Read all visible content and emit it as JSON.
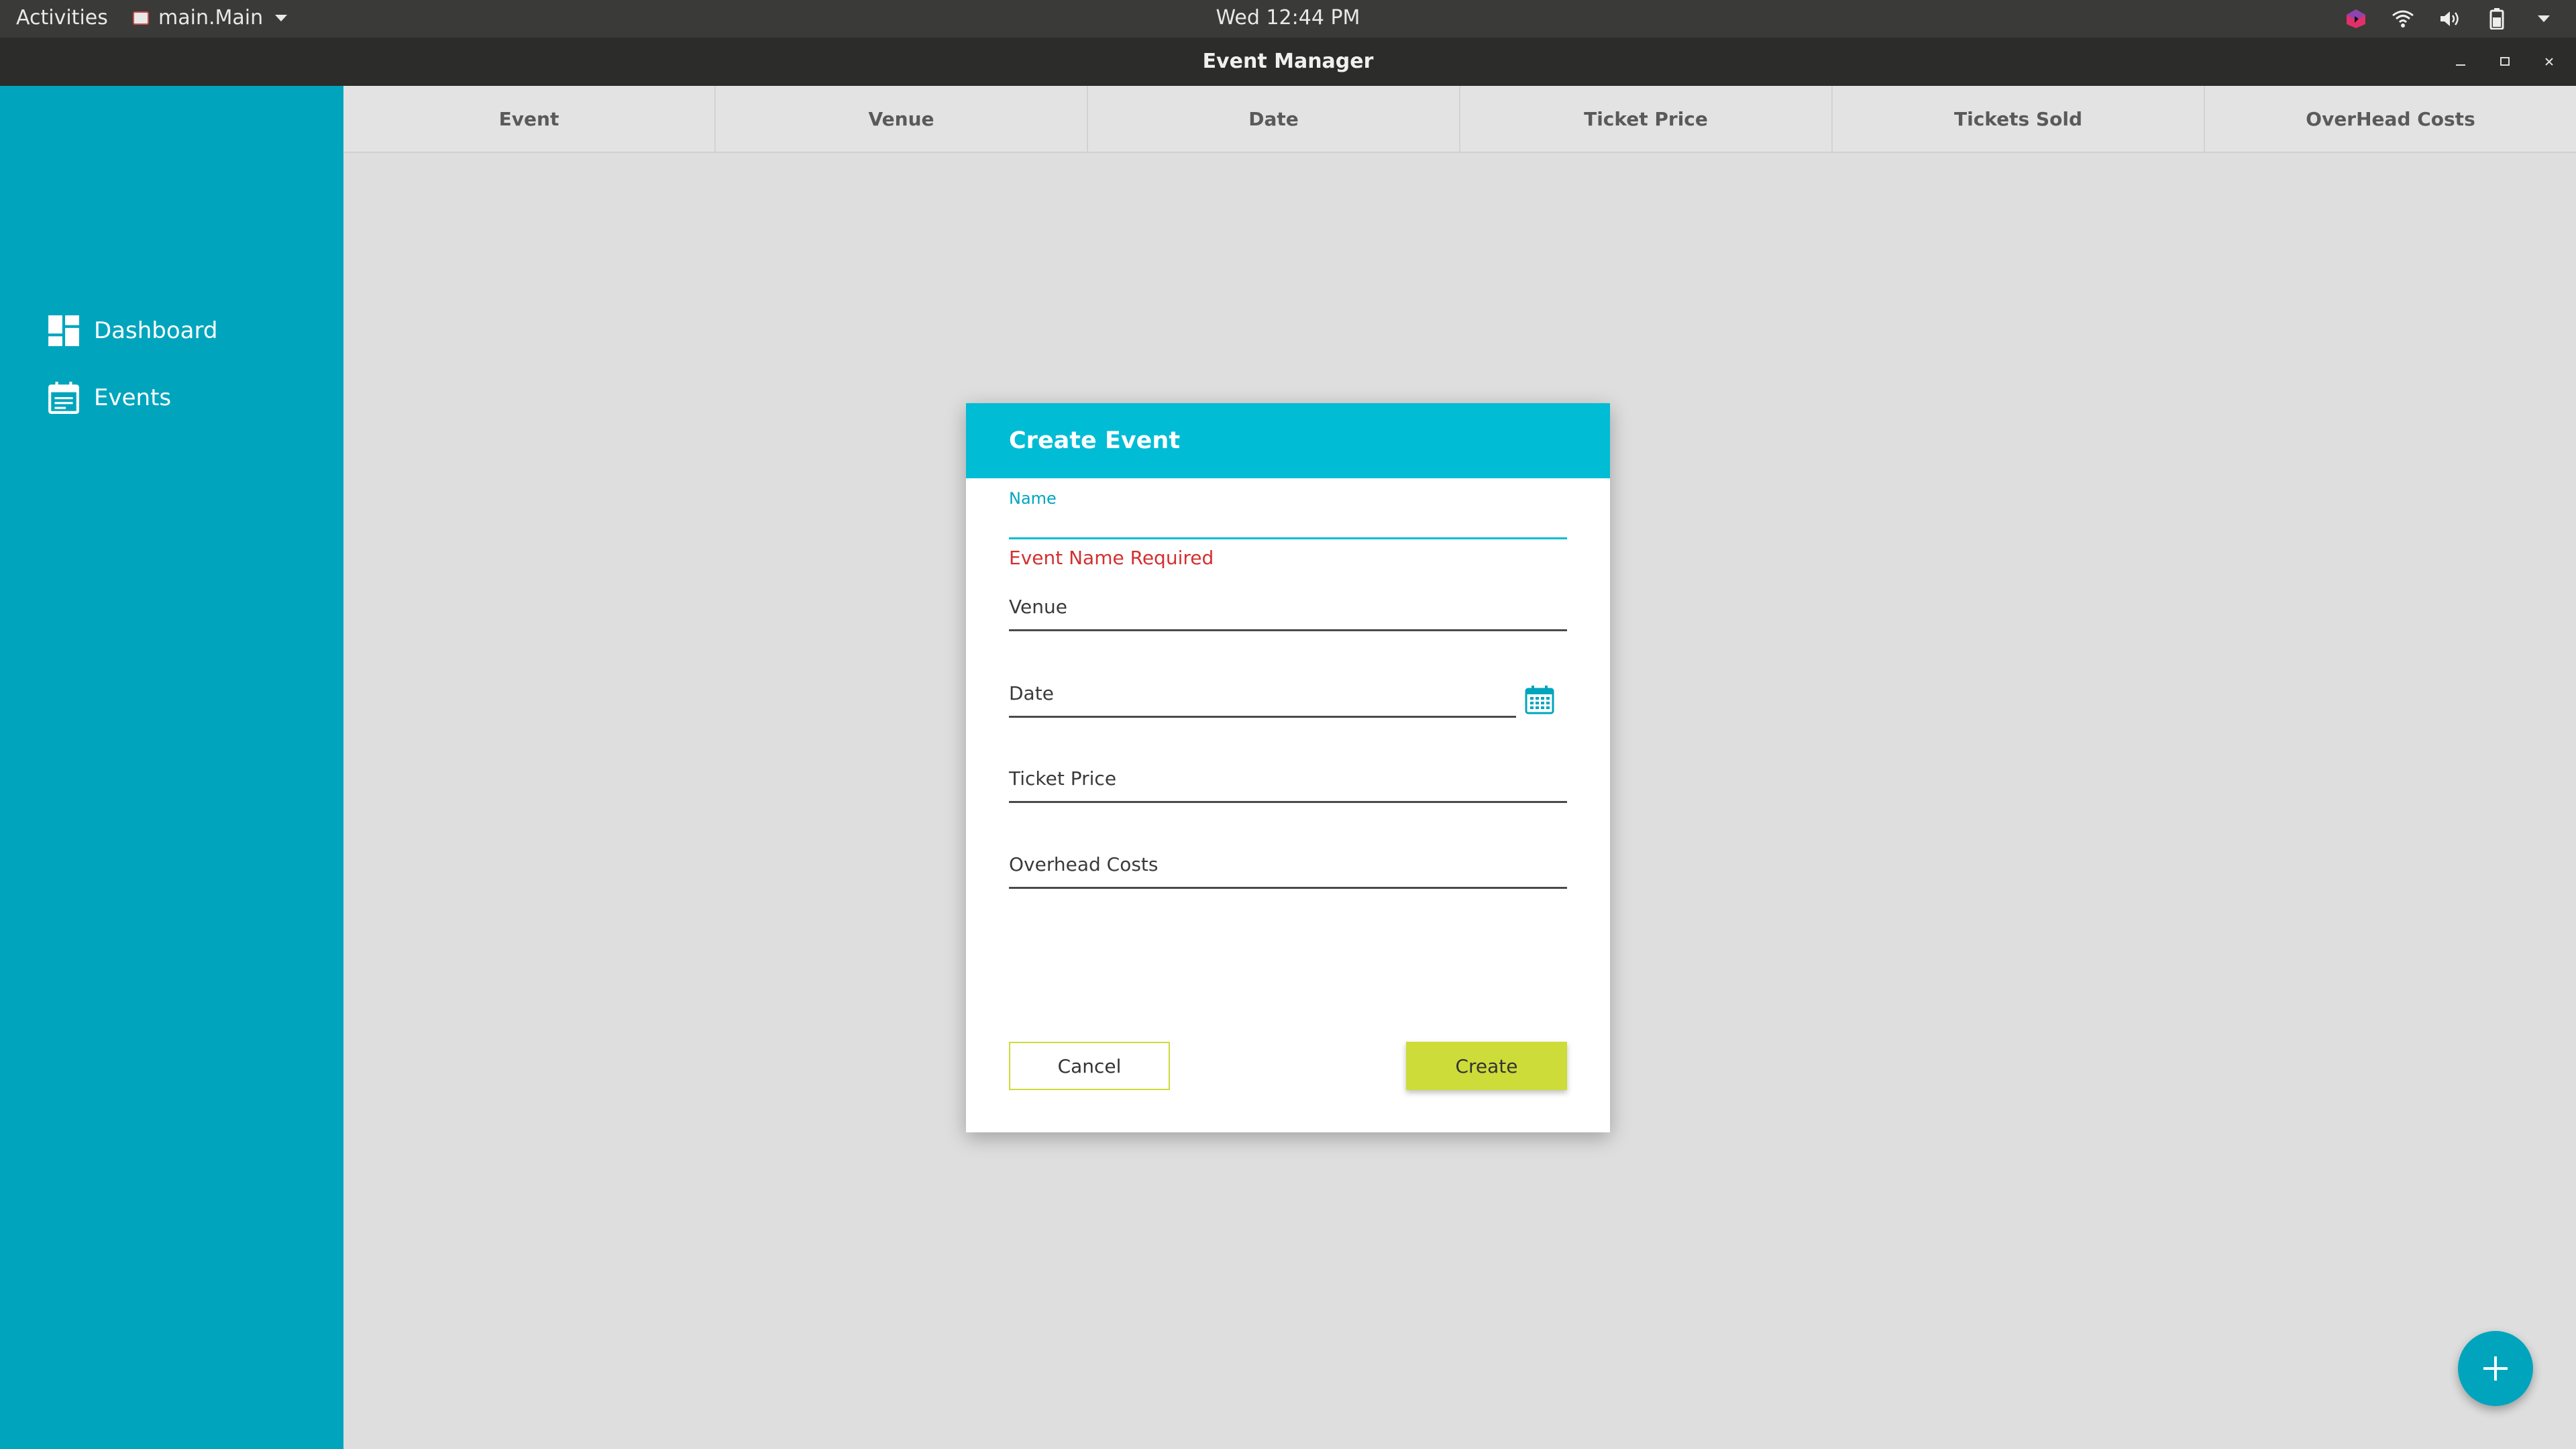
{
  "topbar": {
    "activities": "Activities",
    "app_menu": "main.Main",
    "clock": "Wed 12:44 PM",
    "tray_icons": [
      "app-indicator-icon",
      "wifi-icon",
      "volume-icon",
      "battery-icon",
      "system-menu-caret-icon"
    ]
  },
  "window": {
    "title": "Event Manager",
    "controls": [
      "minimize-icon",
      "maximize-icon",
      "close-icon"
    ]
  },
  "sidebar": {
    "items": [
      {
        "label": "Dashboard",
        "icon": "dashboard-icon"
      },
      {
        "label": "Events",
        "icon": "calendar-icon"
      }
    ]
  },
  "table": {
    "columns": [
      "Event",
      "Venue",
      "Date",
      "Ticket Price",
      "Tickets Sold",
      "OverHead Costs"
    ]
  },
  "dialog": {
    "title": "Create Event",
    "fields": {
      "name_label": "Name",
      "name_value": "",
      "name_error": "Event Name Required",
      "venue_label": "Venue",
      "date_label": "Date",
      "ticket_price_label": "Ticket Price",
      "overhead_label": "Overhead Costs"
    },
    "cancel_label": "Cancel",
    "create_label": "Create"
  },
  "colors": {
    "sidebar": "#00a5bd",
    "dialog_header": "#00bcd4",
    "accent_button": "#cddc39",
    "error": "#d32f2f"
  },
  "fab": {
    "icon": "plus-icon"
  }
}
